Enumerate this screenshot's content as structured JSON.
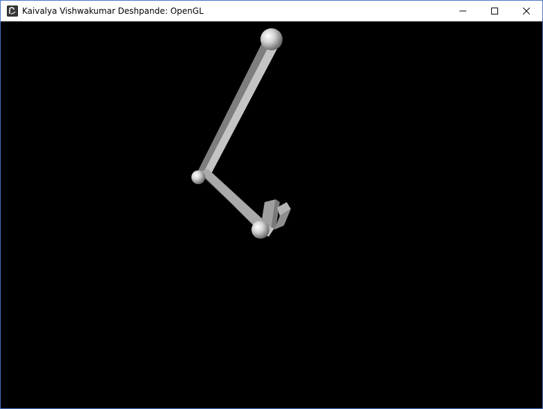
{
  "window": {
    "title": "Kaivalya Vishwakumar Deshpande: OpenGL",
    "app_icon": "app-icon",
    "controls": {
      "minimize_icon": "minimize-icon",
      "maximize_icon": "maximize-icon",
      "close_icon": "close-icon"
    }
  },
  "viewport": {
    "background": "#000000",
    "scene": {
      "object": "robotic-arm",
      "color": "#b8b8b8",
      "parts": [
        "shoulder-joint",
        "upper-arm",
        "elbow-joint",
        "forearm",
        "wrist-joint",
        "gripper"
      ]
    }
  }
}
